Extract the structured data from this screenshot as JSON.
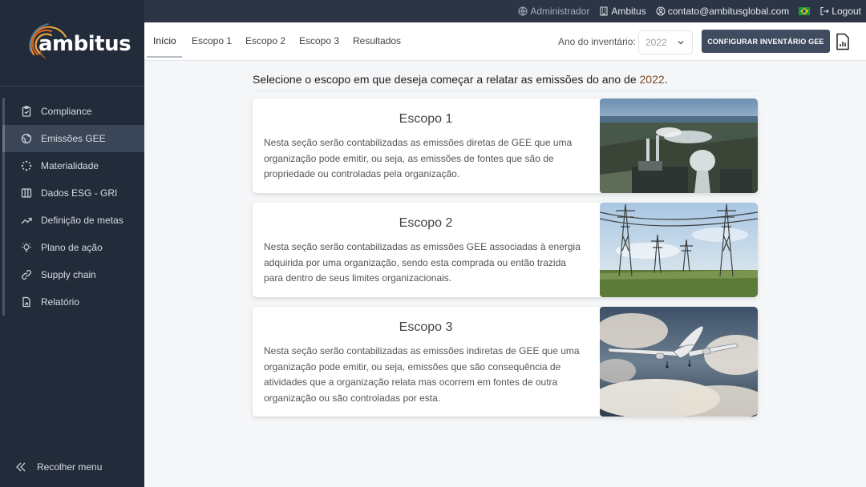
{
  "brand": {
    "name": "ambitus"
  },
  "topbar": {
    "admin": "Administrador",
    "company": "Ambitus",
    "email": "contato@ambitusglobal.com",
    "logout": "Logout"
  },
  "sidebar": {
    "items": [
      {
        "label": "Compliance",
        "icon": "clipboard-icon"
      },
      {
        "label": "Emissões GEE",
        "icon": "globe-icon"
      },
      {
        "label": "Materialidade",
        "icon": "dots-circle-icon"
      },
      {
        "label": "Dados ESG - GRI",
        "icon": "columns-icon"
      },
      {
        "label": "Definição de metas",
        "icon": "trend-up-icon"
      },
      {
        "label": "Plano de ação",
        "icon": "lightbulb-icon"
      },
      {
        "label": "Supply chain",
        "icon": "link-icon"
      },
      {
        "label": "Relatório",
        "icon": "report-icon"
      }
    ],
    "collapse": "Recolher menu"
  },
  "tabs": [
    {
      "label": "Início"
    },
    {
      "label": "Escopo 1"
    },
    {
      "label": "Escopo 2"
    },
    {
      "label": "Escopo 3"
    },
    {
      "label": "Resultados"
    }
  ],
  "year_label": "Ano do inventário:",
  "year_value": "2022",
  "config_button": "CONFIGURAR INVENTÁRIO GEE",
  "intro": {
    "text": "Selecione o escopo em que deseja começar a relatar as emissões do ano de",
    "year": "2022",
    "end": "."
  },
  "cards": [
    {
      "title": "Escopo 1",
      "lines": [
        "Nesta seção serão contabilizadas as emissões diretas de GEE que uma",
        "organização pode emitir, ou seja, as emissões de fontes que são de",
        "propriedade ou controladas pela organização."
      ],
      "image": "power-plant-photo"
    },
    {
      "title": "Escopo 2",
      "lines": [
        "Nesta seção serão contabilizadas as emissões GEE associadas à energia",
        "adquirida por uma organização, sendo esta comprada ou então trazida",
        "para dentro de seus limites organizacionais."
      ],
      "image": "power-lines-photo"
    },
    {
      "title": "Escopo 3",
      "lines": [
        "Nesta seção serão contabilizadas as emissões indiretas de GEE que uma",
        "organização pode emitir, ou seja, emissões que são consequência de",
        "atividades que a organização relata mas ocorrem em fontes de outra",
        "organização ou são controladas por esta."
      ],
      "image": "airplane-photo"
    }
  ],
  "colors": {
    "sidebar": "#222b3a",
    "topbar": "#2c3545",
    "button": "#3f4b5e",
    "accent_year": "#7a4a2a"
  }
}
